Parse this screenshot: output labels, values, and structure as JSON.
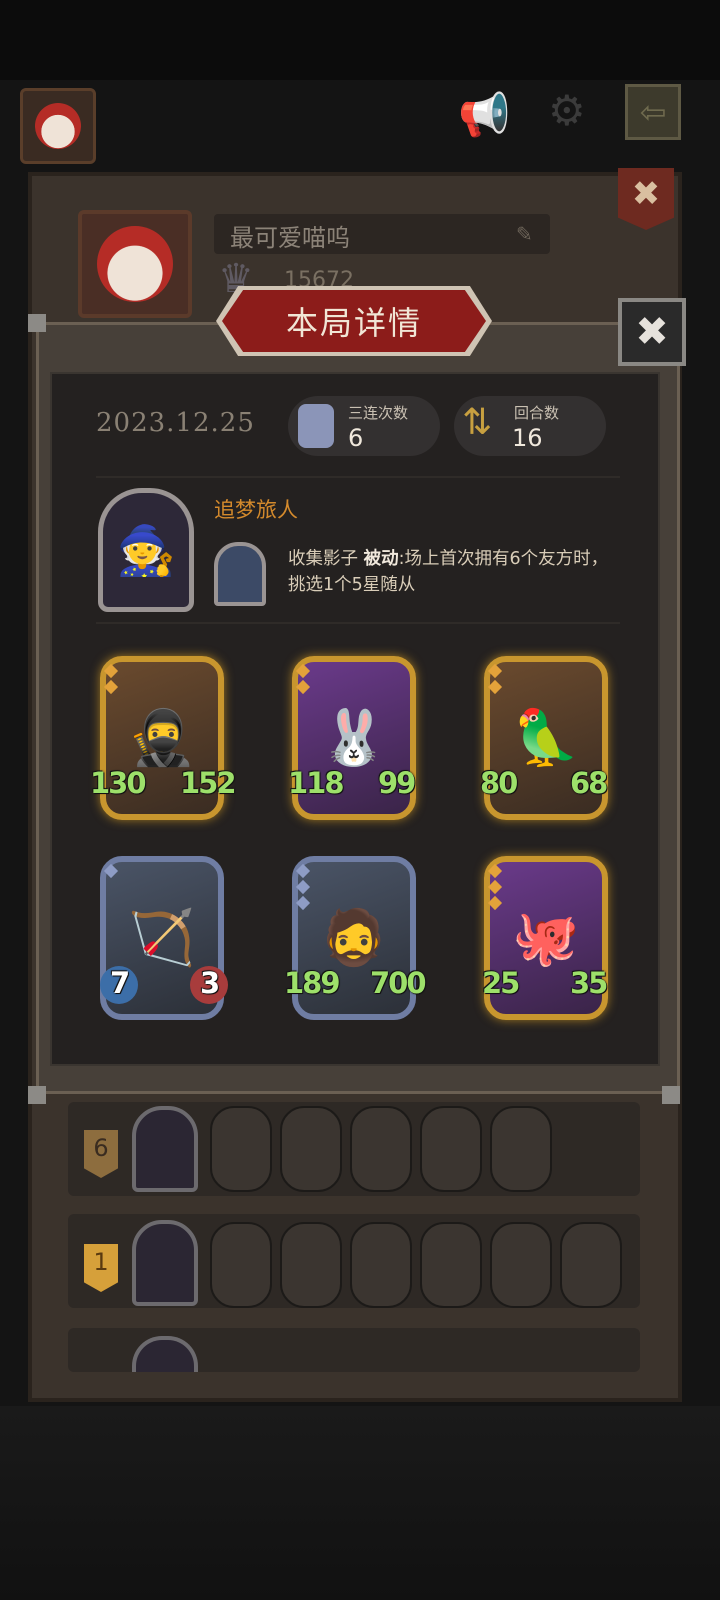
{
  "profile": {
    "name": "最可爱喵呜",
    "score": "15672"
  },
  "modal": {
    "title": "本局详情",
    "date": "2023.12.25",
    "triples_label": "三连次数",
    "triples_value": "6",
    "turns_label": "回合数",
    "turns_value": "16"
  },
  "hero": {
    "name": "追梦旅人",
    "skill_name": "收集影子",
    "skill_type": "被动",
    "skill_desc": ":场上首次拥有6个友方时，挑选1个5星随从"
  },
  "cards": [
    {
      "attack": "130",
      "health": "152",
      "tier": "gold",
      "icon": "hooded-archer"
    },
    {
      "attack": "118",
      "health": "99",
      "tier": "gold",
      "icon": "rabbit-mask"
    },
    {
      "attack": "80",
      "health": "68",
      "tier": "gold",
      "icon": "parrot"
    },
    {
      "attack": "7",
      "health": "3",
      "tier": "silver",
      "icon": "elf-archer"
    },
    {
      "attack": "189",
      "health": "700",
      "tier": "silver",
      "icon": "old-wizard"
    },
    {
      "attack": "25",
      "health": "35",
      "tier": "gold",
      "icon": "octopus-pirate"
    }
  ],
  "history": [
    {
      "rank": "6"
    },
    {
      "rank": "1"
    },
    {
      "rank": ""
    }
  ],
  "colors": {
    "stat_green": "#9de06a",
    "gold_frame": "#c8962e",
    "banner_red": "#8c1c1a",
    "hero_name": "#d48a2c"
  }
}
